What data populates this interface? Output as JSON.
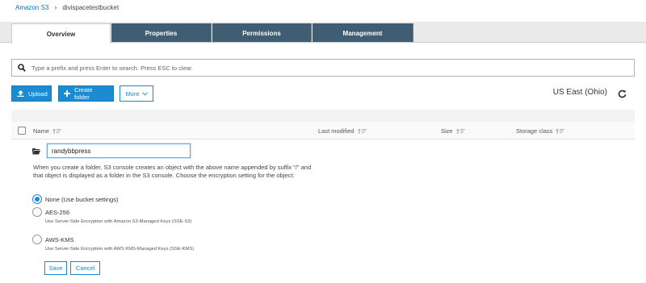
{
  "breadcrumb": {
    "root": "Amazon S3",
    "separator": "›",
    "current": "divispacetestbucket"
  },
  "tabs": [
    {
      "label": "Overview",
      "active": true
    },
    {
      "label": "Properties",
      "active": false
    },
    {
      "label": "Permissions",
      "active": false
    },
    {
      "label": "Management",
      "active": false
    }
  ],
  "search": {
    "placeholder": "Type a prefix and press Enter to search. Press ESC to clear.",
    "value": ""
  },
  "toolbar": {
    "upload_label": "Upload",
    "create_folder_label": "Create folder",
    "more_label": "More",
    "region": "US East (Ohio)"
  },
  "table": {
    "columns": [
      "Name",
      "Last modified",
      "Size",
      "Storage class"
    ]
  },
  "new_folder": {
    "name_value": "randybbpress",
    "description": "When you create a folder, S3 console creates an object with the above name appended by suffix \"/\" and that object is displayed as a folder in the S3 console. Choose the encryption setting for the object:",
    "options": [
      {
        "label": "None (Use bucket settings)",
        "help": "",
        "selected": true
      },
      {
        "label": "AES-256",
        "help": "Use Server-Side Encryption with Amazon S3-Managed Keys (SSE-S3)",
        "selected": false
      },
      {
        "label": "AWS-KMS",
        "help": "Use Server-Side Encryption with AWS KMS-Managed Keys (SSE-KMS)",
        "selected": false
      }
    ],
    "save_label": "Save",
    "cancel_label": "Cancel"
  },
  "colors": {
    "primary": "#1d8bd1",
    "tab_inactive": "#3f5e74",
    "link": "#0073bb"
  },
  "icons": [
    "search-icon",
    "upload-icon",
    "plus-icon",
    "chevron-down-icon",
    "refresh-icon",
    "sort-icon",
    "folder-icon"
  ]
}
